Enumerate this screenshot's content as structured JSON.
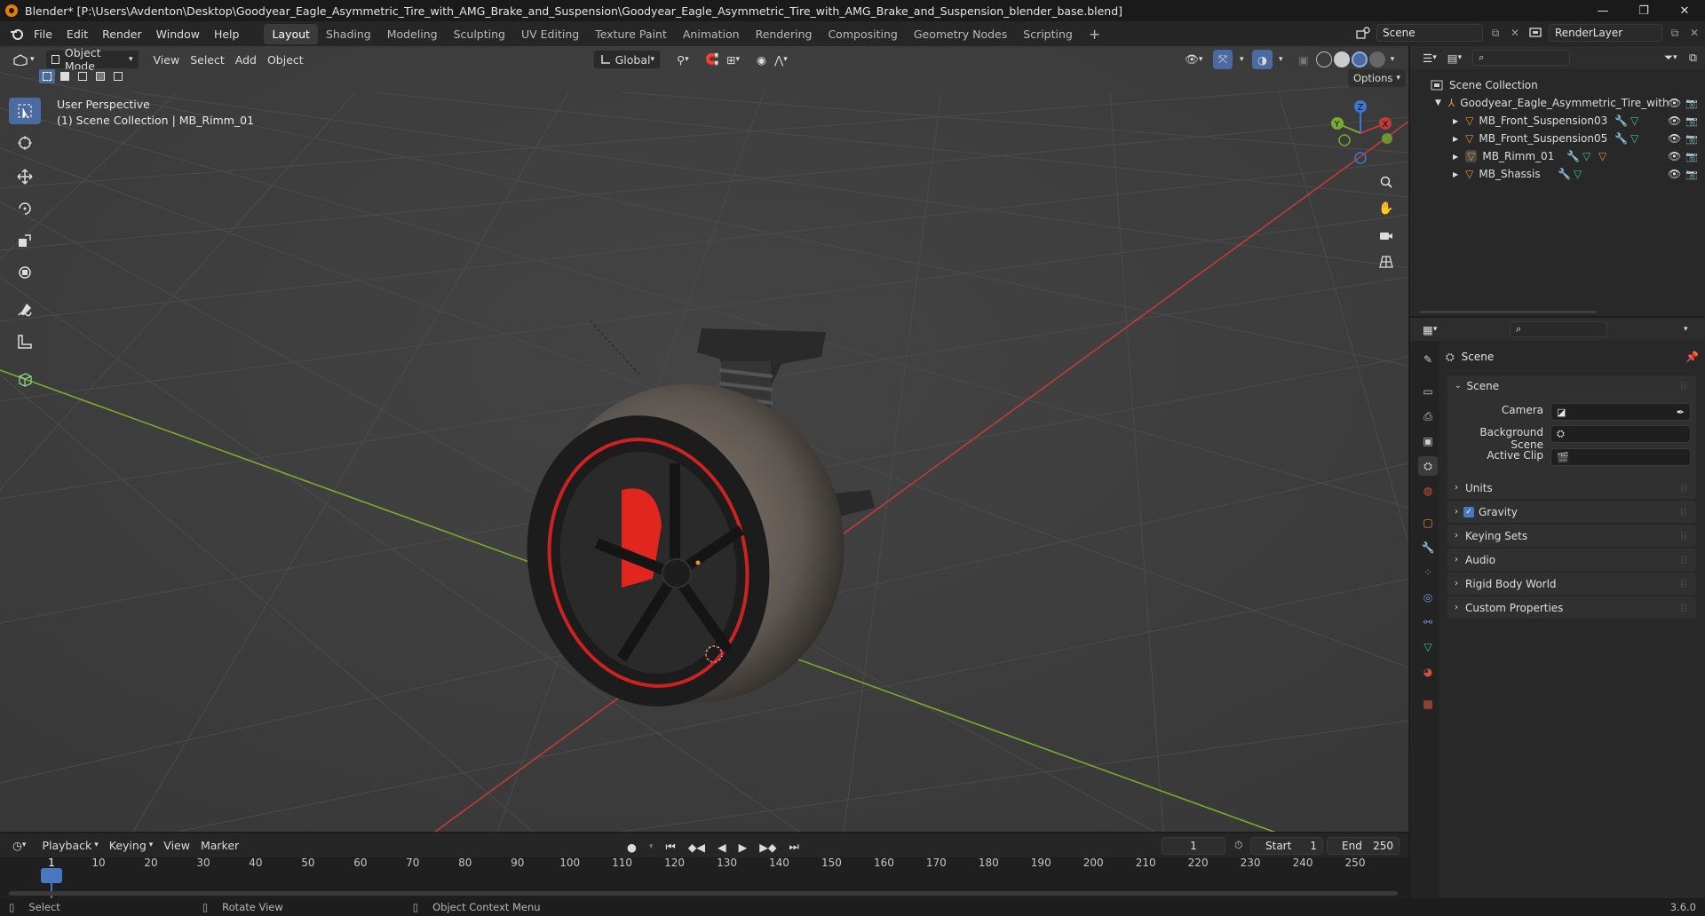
{
  "window": {
    "title": "Blender* [P:\\Users\\Avdenton\\Desktop\\Goodyear_Eagle_Asymmetric_Tire_with_AMG_Brake_and_Suspension\\Goodyear_Eagle_Asymmetric_Tire_with_AMG_Brake_and_Suspension_blender_base.blend]",
    "controls": {
      "minimize": "—",
      "maximize": "❐",
      "close": "✕"
    }
  },
  "menu": [
    "File",
    "Edit",
    "Render",
    "Window",
    "Help"
  ],
  "workspaces": [
    "Layout",
    "Shading",
    "Modeling",
    "Sculpting",
    "UV Editing",
    "Texture Paint",
    "Animation",
    "Rendering",
    "Compositing",
    "Geometry Nodes",
    "Scripting"
  ],
  "active_workspace": "Layout",
  "add_workspace": "+",
  "scene_selector": {
    "value": "Scene"
  },
  "view_layer_selector": {
    "value": "RenderLayer"
  },
  "viewport": {
    "mode": "Object Mode",
    "menus": [
      "View",
      "Select",
      "Add",
      "Object"
    ],
    "orientation": "Global",
    "options_label": "Options",
    "overlay_line1": "User Perspective",
    "overlay_line2": "(1) Scene Collection | MB_Rimm_01",
    "gizmo": {
      "z": "Z",
      "y": "Y",
      "x": "X"
    }
  },
  "outliner": {
    "search_placeholder": "",
    "root": "Scene Collection",
    "collection": "Goodyear_Eagle_Asymmetric_Tire_with",
    "objects": [
      {
        "name": "MB_Front_Suspension03"
      },
      {
        "name": "MB_Front_Suspension05"
      },
      {
        "name": "MB_Rimm_01"
      },
      {
        "name": "MB_Shassis"
      }
    ]
  },
  "properties": {
    "search_placeholder": "",
    "context_title": "Scene",
    "panel_scene": "Scene",
    "fields": [
      {
        "label": "Camera",
        "value": ""
      },
      {
        "label": "Background Scene",
        "value": ""
      },
      {
        "label": "Active Clip",
        "value": ""
      }
    ],
    "panels": [
      "Units",
      "Gravity",
      "Keying Sets",
      "Audio",
      "Rigid Body World",
      "Custom Properties"
    ],
    "gravity_checked": true
  },
  "timeline": {
    "menus": [
      "Playback",
      "Keying",
      "View",
      "Marker"
    ],
    "current_frame": "1",
    "start_label": "Start",
    "start": "1",
    "end_label": "End",
    "end": "250",
    "ticks": [
      "1",
      "10",
      "20",
      "30",
      "40",
      "50",
      "60",
      "70",
      "80",
      "90",
      "100",
      "110",
      "120",
      "130",
      "140",
      "150",
      "160",
      "170",
      "180",
      "190",
      "200",
      "210",
      "220",
      "230",
      "240",
      "250"
    ]
  },
  "statusbar": {
    "hints": [
      "Select",
      "Rotate View",
      "Object Context Menu"
    ],
    "version": "3.6.0"
  },
  "colors": {
    "accent_blue": "#4a6aa0",
    "object_orange": "#e8912d",
    "modifier_blue": "#6a9bd8",
    "mesh_green": "#38c48a",
    "x_axis": "#c33a3a",
    "y_axis": "#7bab2a"
  }
}
